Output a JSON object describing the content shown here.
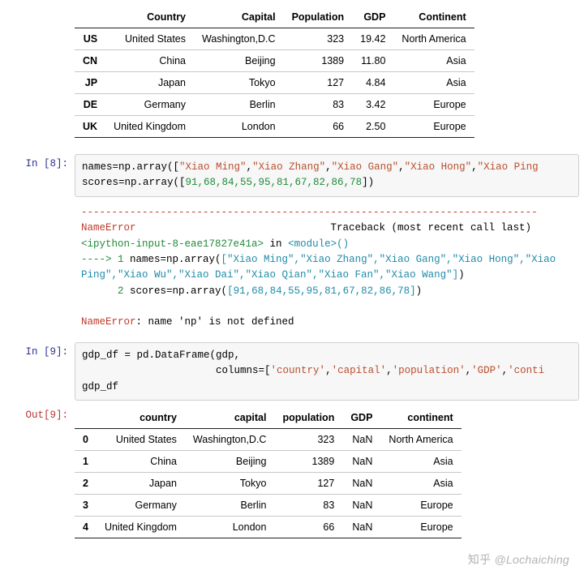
{
  "prompts": {
    "in8": "In [8]:",
    "in9": "In [9]:",
    "out9": "Out[9]:"
  },
  "tableTop": {
    "headers": [
      "",
      "Country",
      "Capital",
      "Population",
      "GDP",
      "Continent"
    ],
    "rows": [
      {
        "idx": "US",
        "country": "United States",
        "capital": "Washington,D.C",
        "pop": "323",
        "gdp": "19.42",
        "cont": "North America"
      },
      {
        "idx": "CN",
        "country": "China",
        "capital": "Beijing",
        "pop": "1389",
        "gdp": "11.80",
        "cont": "Asia"
      },
      {
        "idx": "JP",
        "country": "Japan",
        "capital": "Tokyo",
        "pop": "127",
        "gdp": "4.84",
        "cont": "Asia"
      },
      {
        "idx": "DE",
        "country": "Germany",
        "capital": "Berlin",
        "pop": "83",
        "gdp": "3.42",
        "cont": "Europe"
      },
      {
        "idx": "UK",
        "country": "United Kingdom",
        "capital": "London",
        "pop": "66",
        "gdp": "2.50",
        "cont": "Europe"
      }
    ]
  },
  "code8": {
    "line1a": "names=np.array([",
    "line1b": "\"Xiao Ming\"",
    "line1c": ",",
    "line1d": "\"Xiao Zhang\"",
    "line1e": ",",
    "line1f": "\"Xiao Gang\"",
    "line1g": ",",
    "line1h": "\"Xiao Hong\"",
    "line1i": ",",
    "line1j": "\"Xiao Ping",
    "line2a": "scores=np.array([",
    "nums": "91,68,84,55,95,81,67,82,86,78",
    "line2b": "])"
  },
  "trace8": {
    "dashes": "---------------------------------------------------------------------------",
    "errName": "NameError",
    "tbLabel": "Traceback (most recent call last)",
    "ipy": "<ipython-input-8-eae17827e41a>",
    "inWord": " in ",
    "module": "<module>",
    "parens": "()",
    "arrow": "----> 1 ",
    "arrCode": "names=np.array(",
    "arrList1": "[\"Xiao Ming\",\"Xiao Zhang\",\"Xiao Gang\",\"Xiao Hong\",\"Xiao Ping\",\"Xiao Wu\",\"Xiao Dai\",\"Xiao Qian\",\"Xiao Fan\",\"Xiao Wang\"]",
    "close": ")",
    "line2lead": "      2 ",
    "line2code": "scores=np.array(",
    "line2nums": "[91,68,84,55,95,81,67,82,86,78]",
    "errFinal": "NameError",
    "errMsg": ": name 'np' is not defined"
  },
  "code9": {
    "line1": "gdp_df = pd.DataFrame(gdp,",
    "line2a": "                      columns=[",
    "s1": "'country'",
    "c": ",",
    "s2": "'capital'",
    "s3": "'population'",
    "s4": "'GDP'",
    "s5": "'conti",
    "line3": "gdp_df"
  },
  "tableOut": {
    "headers": [
      "",
      "country",
      "capital",
      "population",
      "GDP",
      "continent"
    ],
    "rows": [
      {
        "idx": "0",
        "country": "United States",
        "capital": "Washington,D.C",
        "pop": "323",
        "gdp": "NaN",
        "cont": "North America"
      },
      {
        "idx": "1",
        "country": "China",
        "capital": "Beijing",
        "pop": "1389",
        "gdp": "NaN",
        "cont": "Asia"
      },
      {
        "idx": "2",
        "country": "Japan",
        "capital": "Tokyo",
        "pop": "127",
        "gdp": "NaN",
        "cont": "Asia"
      },
      {
        "idx": "3",
        "country": "Germany",
        "capital": "Berlin",
        "pop": "83",
        "gdp": "NaN",
        "cont": "Europe"
      },
      {
        "idx": "4",
        "country": "United Kingdom",
        "capital": "London",
        "pop": "66",
        "gdp": "NaN",
        "cont": "Europe"
      }
    ]
  },
  "watermark": {
    "kanji": "知乎",
    "handle": "@Lochaiching"
  }
}
